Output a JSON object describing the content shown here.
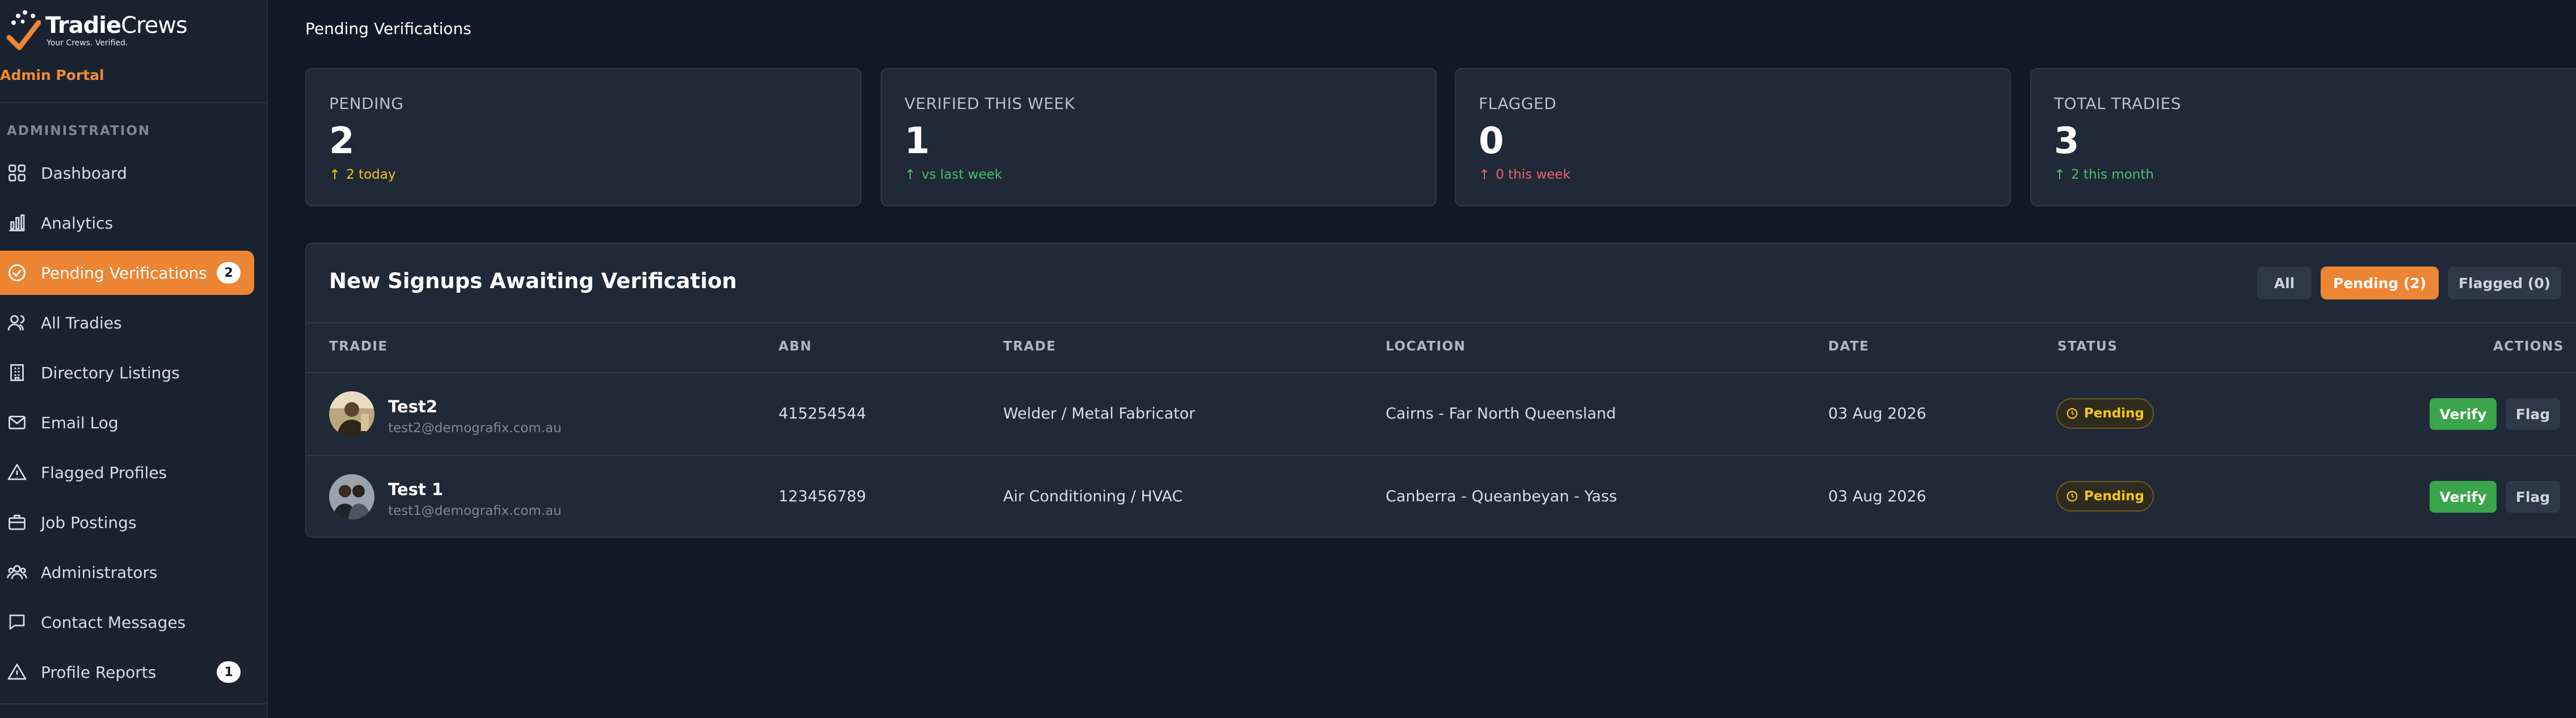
{
  "brand": {
    "name_bold": "Tradie",
    "name_light": "Crews",
    "tagline": "Your Crews. Verified.",
    "portal": "Admin Portal",
    "accent": "#ec8534"
  },
  "sidebar": {
    "section": "ADMINISTRATION",
    "items": [
      {
        "label": "Dashboard",
        "icon": "grid-icon"
      },
      {
        "label": "Analytics",
        "icon": "bar-chart-icon"
      },
      {
        "label": "Pending Verifications",
        "icon": "check-circle-icon",
        "badge": "2",
        "active": true
      },
      {
        "label": "All Tradies",
        "icon": "users-icon"
      },
      {
        "label": "Directory Listings",
        "icon": "building-icon"
      },
      {
        "label": "Email Log",
        "icon": "mail-icon"
      },
      {
        "label": "Flagged Profiles",
        "icon": "warning-icon"
      },
      {
        "label": "Job Postings",
        "icon": "briefcase-icon"
      },
      {
        "label": "Administrators",
        "icon": "user-group-icon"
      },
      {
        "label": "Contact Messages",
        "icon": "message-icon"
      },
      {
        "label": "Profile Reports",
        "icon": "warning-icon",
        "badge": "1"
      }
    ]
  },
  "page": {
    "title": "Pending Verifications"
  },
  "stats": [
    {
      "label": "PENDING",
      "value": "2",
      "delta": "2 today",
      "delta_color": "#f5c518"
    },
    {
      "label": "VERIFIED THIS WEEK",
      "value": "1",
      "delta": "vs last week",
      "delta_color": "#49c167"
    },
    {
      "label": "FLAGGED",
      "value": "0",
      "delta": "0 this week",
      "delta_color": "#f0616d"
    },
    {
      "label": "TOTAL TRADIES",
      "value": "3",
      "delta": "2 this month",
      "delta_color": "#49c167"
    }
  ],
  "panel": {
    "title": "New Signups Awaiting Verification",
    "filters": {
      "all": "All",
      "pending": "Pending (2)",
      "flagged": "Flagged (0)"
    },
    "columns": {
      "tradie": "TRADIE",
      "abn": "ABN",
      "trade": "TRADE",
      "location": "LOCATION",
      "date": "DATE",
      "status": "STATUS",
      "actions": "ACTIONS"
    },
    "rows": [
      {
        "name": "Test2",
        "email": "test2@demografix.com.au",
        "abn": "415254544",
        "trade": "Welder / Metal Fabricator",
        "location": "Cairns - Far North Queensland",
        "date": "03 Aug 2026",
        "status": "Pending",
        "verify": "Verify",
        "flag": "Flag"
      },
      {
        "name": "Test 1",
        "email": "test1@demografix.com.au",
        "abn": "123456789",
        "trade": "Air Conditioning / HVAC",
        "location": "Canberra - Queanbeyan - Yass",
        "date": "03 Aug 2026",
        "status": "Pending",
        "verify": "Verify",
        "flag": "Flag"
      }
    ]
  }
}
